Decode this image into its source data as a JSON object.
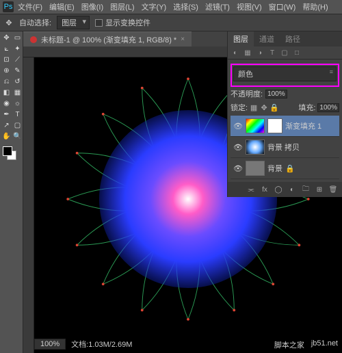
{
  "menubar": {
    "logo": "Ps",
    "items": [
      "文件(F)",
      "编辑(E)",
      "图像(I)",
      "图层(L)",
      "文字(Y)",
      "选择(S)",
      "滤镜(T)",
      "视图(V)",
      "窗口(W)",
      "帮助(H)"
    ]
  },
  "options": {
    "auto_select_label": "自动选择:",
    "auto_select_value": "图层",
    "show_transform_label": "显示变换控件"
  },
  "document": {
    "tab_title": "未标题-1 @ 100% (渐变填充 1, RGB/8) *"
  },
  "status": {
    "zoom": "100%",
    "docsize": "文档:1.03M/2.69M"
  },
  "panels": {
    "tabs": [
      "图层",
      "通道",
      "路径"
    ],
    "blend_mode": "颜色",
    "opacity_label": "不透明度:",
    "opacity_value": "100%",
    "lock_label": "锁定:",
    "fill_label": "填充:",
    "fill_value": "100%",
    "layers": [
      {
        "name": "渐变填充 1"
      },
      {
        "name": "背景 拷贝"
      },
      {
        "name": "背景"
      }
    ]
  },
  "watermarks": {
    "left": "脚本之家",
    "right": "jb51.net"
  },
  "colors": {
    "highlight": "#ff00ff",
    "selection": "#5a7aa8"
  }
}
